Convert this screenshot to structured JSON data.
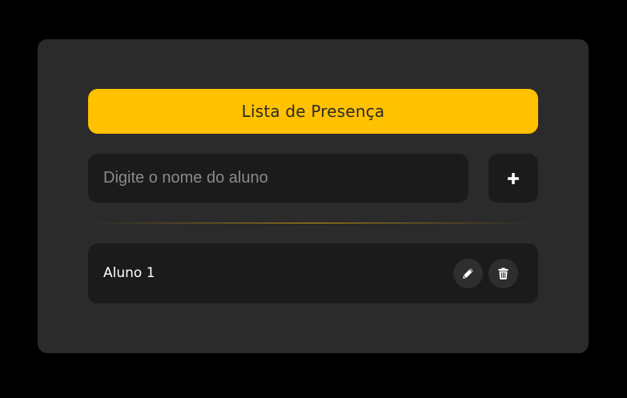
{
  "header": {
    "title": "Lista de Presença"
  },
  "form": {
    "name_placeholder": "Digite o nome do aluno",
    "name_value": "",
    "add_icon": "plus-icon"
  },
  "students": [
    {
      "name": "Aluno 1",
      "edit_icon": "pencil-icon",
      "delete_icon": "trash-icon"
    }
  ],
  "colors": {
    "page_background": "#000000",
    "card_background": "#2b2b2b",
    "accent": "#ffc100",
    "field_background": "#1b1b1b",
    "icon_button_background": "#2e2e2e"
  }
}
